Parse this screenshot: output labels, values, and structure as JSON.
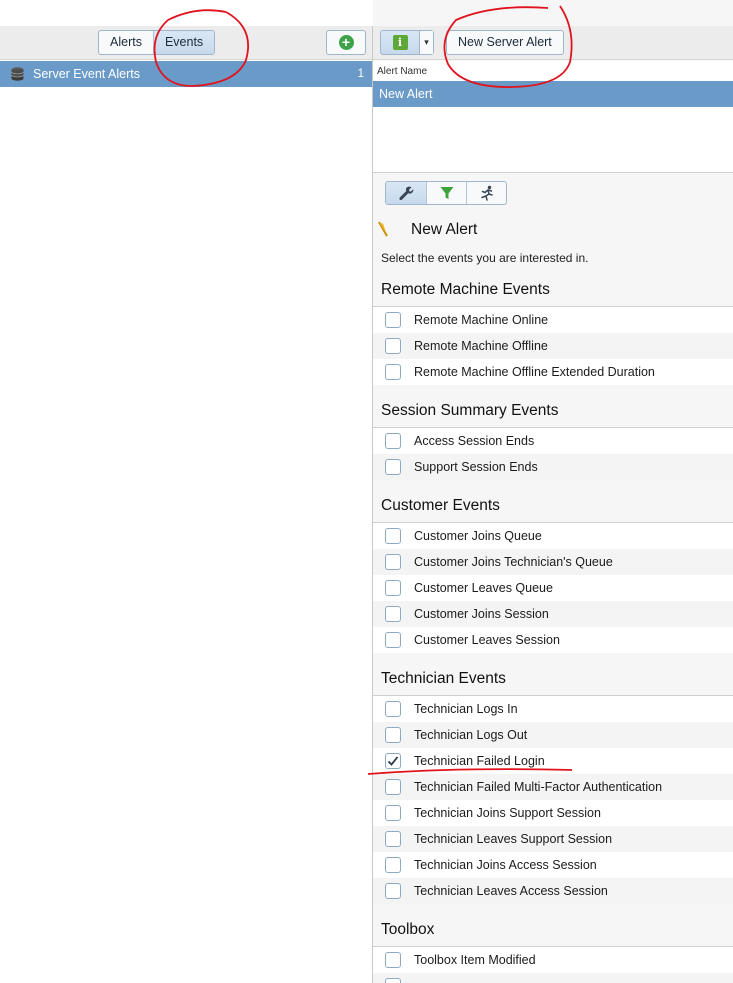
{
  "left_toolbar": {
    "tabs": [
      {
        "label": "Alerts",
        "active": false
      },
      {
        "label": "Events",
        "active": true
      }
    ],
    "add_icon": "plus-circle-icon"
  },
  "tree": {
    "item": {
      "icon": "database-icon",
      "label": "Server Event Alerts",
      "count": "1"
    }
  },
  "right_toolbar": {
    "info_icon": "info-icon",
    "new_alert_label": "New Server Alert"
  },
  "alert_list": {
    "column_header": "Alert Name",
    "rows": [
      "New Alert"
    ]
  },
  "detail_tabs": [
    "wrench-icon",
    "filter-icon",
    "run-action-icon"
  ],
  "detail": {
    "title": "New Alert",
    "description": "Select the events you are interested in."
  },
  "sections": [
    {
      "title": "Remote Machine Events",
      "events": [
        {
          "label": "Remote Machine Online",
          "checked": false
        },
        {
          "label": "Remote Machine Offline",
          "checked": false
        },
        {
          "label": "Remote Machine Offline Extended Duration",
          "checked": false
        }
      ]
    },
    {
      "title": "Session Summary Events",
      "events": [
        {
          "label": "Access Session Ends",
          "checked": false
        },
        {
          "label": "Support Session Ends",
          "checked": false
        }
      ]
    },
    {
      "title": "Customer Events",
      "events": [
        {
          "label": "Customer Joins Queue",
          "checked": false
        },
        {
          "label": "Customer Joins Technician's Queue",
          "checked": false
        },
        {
          "label": "Customer Leaves Queue",
          "checked": false
        },
        {
          "label": "Customer Joins Session",
          "checked": false
        },
        {
          "label": "Customer Leaves Session",
          "checked": false
        }
      ]
    },
    {
      "title": "Technician Events",
      "events": [
        {
          "label": "Technician Logs In",
          "checked": false
        },
        {
          "label": "Technician Logs Out",
          "checked": false
        },
        {
          "label": "Technician Failed Login",
          "checked": true
        },
        {
          "label": "Technician Failed Multi-Factor Authentication",
          "checked": false
        },
        {
          "label": "Technician Joins Support Session",
          "checked": false
        },
        {
          "label": "Technician Leaves Support Session",
          "checked": false
        },
        {
          "label": "Technician Joins Access Session",
          "checked": false
        },
        {
          "label": "Technician Leaves Access Session",
          "checked": false
        }
      ]
    },
    {
      "title": "Toolbox",
      "events": [
        {
          "label": "Toolbox Item Modified",
          "checked": false
        },
        {
          "label": "",
          "checked": false
        }
      ]
    }
  ],
  "colors": {
    "selection": "#6a9ac8",
    "annotation": "#e0141e",
    "add_green": "#3da24a"
  }
}
